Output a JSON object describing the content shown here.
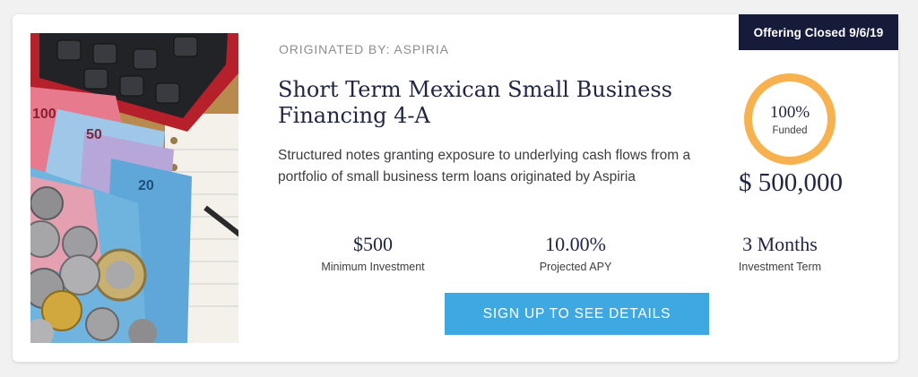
{
  "badge": {
    "label": "Offering Closed 9/6/19"
  },
  "offering": {
    "originator": "ORIGINATED BY: ASPIRIA",
    "title": "Short Term Mexican Small Business Financing 4-A",
    "description": "Structured notes granting exposure to underlying cash flows from a portfolio of small business term loans originated by Aspiria"
  },
  "stats": [
    {
      "value": "$500",
      "label": "Minimum Investment"
    },
    {
      "value": "10.00%",
      "label": "Projected APY"
    },
    {
      "value": "3 Months",
      "label": "Investment Term"
    }
  ],
  "cta": {
    "label": "SIGN UP TO SEE DETAILS"
  },
  "funding": {
    "percent_label": "100%",
    "status": "Funded",
    "progress": 1.0,
    "amount": "$ 500,000"
  },
  "colors": {
    "navy": "#171b3a",
    "ring": "#f7b24f",
    "button": "#3ea8e2",
    "title": "#1f2542"
  },
  "image": {
    "subject": "calculator, Mexican peso banknotes and coins, pen on notepad"
  }
}
